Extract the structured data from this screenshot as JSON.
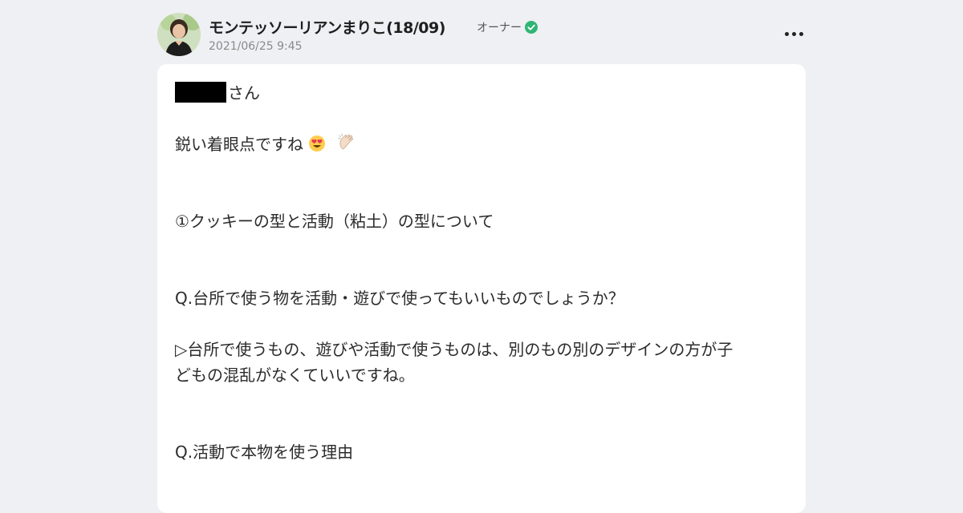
{
  "post": {
    "author": "モンテッソーリアンまりこ(18/09)",
    "role": "オーナー",
    "timestamp": "2021/06/25 9:45"
  },
  "body": {
    "greeting_suffix": "さん",
    "line1": "鋭い着眼点ですね",
    "line2": "①クッキーの型と活動（粘土）の型について",
    "line3": "Q.台所で使う物を活動・遊びで使ってもいいものでしょうか？",
    "line4a": "▷台所で使うもの、遊びや活動で使うものは、別のもの別のデザインの方が子",
    "line4b": "どもの混乱がなくていいですね。",
    "line5": "Q.活動で本物を使う理由"
  },
  "icons": {
    "verified": "check-badge-icon",
    "more": "more-options-icon",
    "emoji1": "heart-eyes-emoji-icon",
    "emoji2": "clapping-hands-emoji-icon"
  },
  "colors": {
    "verified": "#2fb573",
    "background": "#eff0f3",
    "card": "#ffffff"
  }
}
